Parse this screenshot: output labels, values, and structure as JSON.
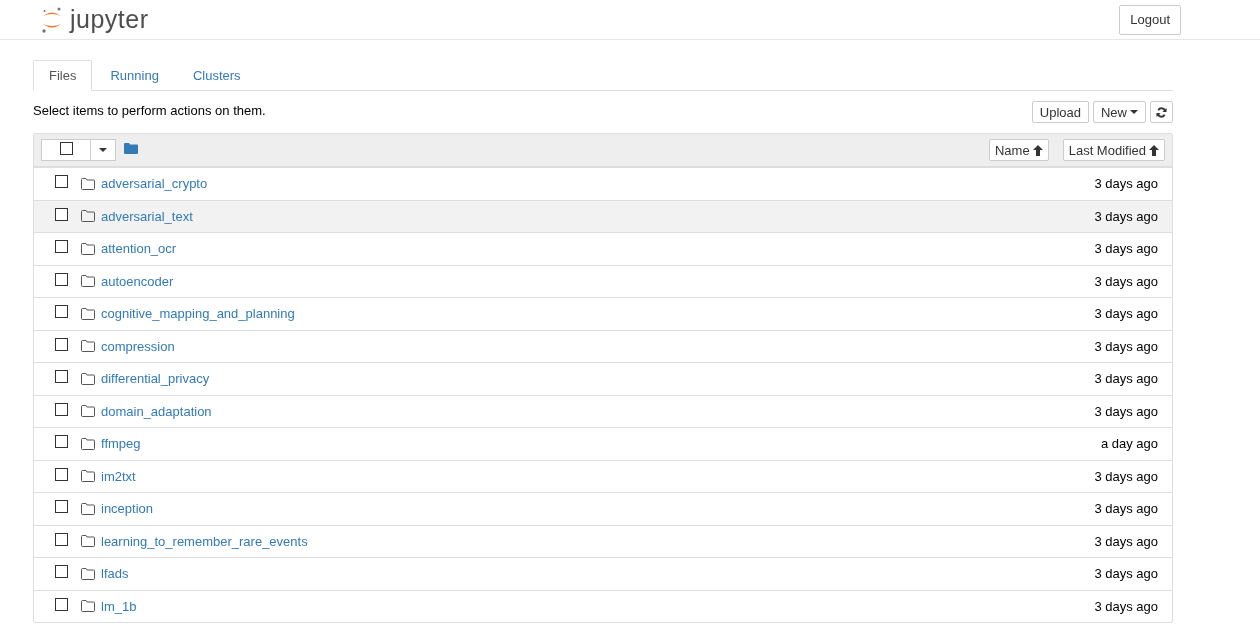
{
  "header": {
    "logo_text": "jupyter",
    "logout": "Logout"
  },
  "tabs": [
    {
      "label": "Files",
      "selected": true
    },
    {
      "label": "Running",
      "selected": false
    },
    {
      "label": "Clusters",
      "selected": false
    }
  ],
  "toolbar": {
    "hint": "Select items to perform actions on them.",
    "buttons": [
      {
        "kind": "text",
        "label": "Upload"
      },
      {
        "kind": "dropdown",
        "label": "New"
      },
      {
        "kind": "refresh"
      }
    ]
  },
  "list_header": {
    "select_all_checked": false,
    "sort_buttons": [
      "Name",
      "Last Modified"
    ]
  },
  "rows": [
    {
      "name": "adversarial_crypto",
      "modified": "3 days ago",
      "checked": false,
      "highlighted": false
    },
    {
      "name": "adversarial_text",
      "modified": "3 days ago",
      "checked": false,
      "highlighted": true
    },
    {
      "name": "attention_ocr",
      "modified": "3 days ago",
      "checked": false,
      "highlighted": false
    },
    {
      "name": "autoencoder",
      "modified": "3 days ago",
      "checked": false,
      "highlighted": false
    },
    {
      "name": "cognitive_mapping_and_planning",
      "modified": "3 days ago",
      "checked": false,
      "highlighted": false
    },
    {
      "name": "compression",
      "modified": "3 days ago",
      "checked": false,
      "highlighted": false
    },
    {
      "name": "differential_privacy",
      "modified": "3 days ago",
      "checked": false,
      "highlighted": false
    },
    {
      "name": "domain_adaptation",
      "modified": "3 days ago",
      "checked": false,
      "highlighted": false
    },
    {
      "name": "ffmpeg",
      "modified": "a day ago",
      "checked": false,
      "highlighted": false
    },
    {
      "name": "im2txt",
      "modified": "3 days ago",
      "checked": false,
      "highlighted": false
    },
    {
      "name": "inception",
      "modified": "3 days ago",
      "checked": false,
      "highlighted": false
    },
    {
      "name": "learning_to_remember_rare_events",
      "modified": "3 days ago",
      "checked": false,
      "highlighted": false
    },
    {
      "name": "lfads",
      "modified": "3 days ago",
      "checked": false,
      "highlighted": false
    },
    {
      "name": "lm_1b",
      "modified": "3 days ago",
      "checked": false,
      "highlighted": false
    }
  ]
}
